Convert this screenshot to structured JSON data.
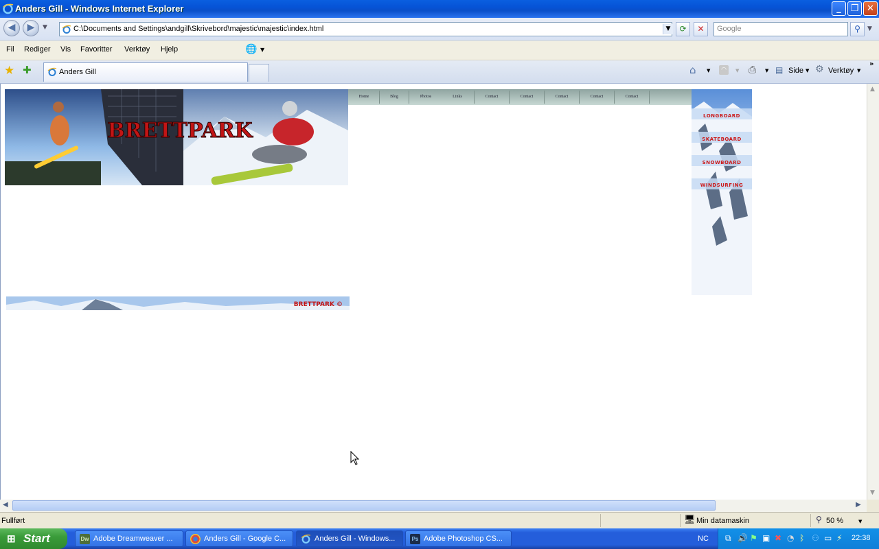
{
  "window": {
    "title": "Anders Gill - Windows Internet Explorer"
  },
  "address_bar": {
    "url": "C:\\Documents and Settings\\andgill\\Skrivebord\\majestic\\majestic\\index.html"
  },
  "search": {
    "placeholder": "Google"
  },
  "menu": {
    "items": [
      "Fil",
      "Rediger",
      "Vis",
      "Favoritter",
      "Verktøy",
      "Hjelp"
    ]
  },
  "tabs": {
    "active_label": "Anders Gill"
  },
  "command_bar": {
    "page_label": "Side",
    "tools_label": "Verktøy"
  },
  "webpage": {
    "banner_text": "BRETTPARK",
    "nav_links": [
      "Home",
      "Blog",
      "Photos",
      "Links",
      "Contact",
      "Contact",
      "Contact",
      "Contact",
      "Contact"
    ],
    "side_links": [
      "LONGBOARD",
      "SKATEBOARD",
      "SNOWBOARD",
      "WINDSURFING"
    ],
    "footer_text": "BRETTPARK ©"
  },
  "status_bar": {
    "status": "Fullført",
    "zone": "Min datamaskin",
    "zoom": "50 %"
  },
  "taskbar": {
    "start_label": "Start",
    "items": [
      {
        "icon_text": "Dw",
        "label": "Adobe Dreamweaver ...",
        "active": false
      },
      {
        "icon_text": "",
        "label": "Anders Gill - Google C...",
        "active": false
      },
      {
        "icon_text": "",
        "label": "Anders Gill - Windows...",
        "active": true
      },
      {
        "icon_text": "Ps",
        "label": "Adobe Photoshop CS...",
        "active": false
      }
    ],
    "language": "NC",
    "clock": "22:38"
  },
  "colors": {
    "xp_blue": "#245edb",
    "banner_red": "#cc1a1a",
    "sky": "#8fb9e6"
  }
}
